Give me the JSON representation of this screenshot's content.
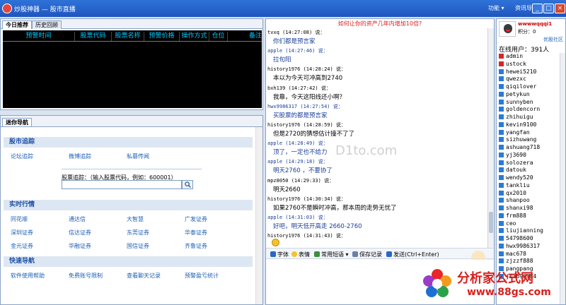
{
  "window": {
    "title": "炒股神器 — 股市直播",
    "menu_function": "功能",
    "menu_info_nav": "资讯导航",
    "min": "_",
    "max": "□",
    "close": "×"
  },
  "top_panel": {
    "tabs": [
      "今日推荐",
      "历史回顾"
    ],
    "columns": [
      "预警时间",
      "股票代码",
      "股票名称",
      "预警价格",
      "操作方式",
      "仓位",
      "备注"
    ]
  },
  "nav_panel": {
    "tab": "迷你导航",
    "sections": {
      "market_tracking": {
        "title": "股市追踪",
        "links": [
          "论坛追踪",
          "微博追踪",
          "私募传闻"
        ],
        "search_label": "股票追踪：（输入股票代码，例如：600001）",
        "search_value": ""
      },
      "realtime": {
        "title": "实时行情",
        "links": [
          "同花顺",
          "通达信",
          "大智慧",
          "广发证券",
          "深圳证券",
          "信达证券",
          "东莞证券",
          "华泰证券",
          "金元证券",
          "华融证券",
          "国信证券",
          "齐鲁证券"
        ]
      },
      "quick": {
        "title": "快速导航",
        "links": [
          "软件使用帮助",
          "免费账号限制",
          "查看聊天记录",
          "预警盈亏统计"
        ]
      }
    }
  },
  "chat": {
    "banner": "如何让你的资产几年内增加10倍?",
    "messages": [
      {
        "header": "tvxq (14:27:08) 说：",
        "body": "你们都是预言家",
        "hcolor": "black",
        "bcolor": "blue"
      },
      {
        "header": "apple (14:27:46) 说：",
        "body": "拉旬阳",
        "hcolor": "blue",
        "bcolor": "blue"
      },
      {
        "header": "history1976 (14:28:24) 说：",
        "body": "本以为今天可冲高到2740",
        "hcolor": "black",
        "bcolor": "black"
      },
      {
        "header": "bxh139 (14:27:42) 说：",
        "body": "我靠，今天这阳线还小啊？",
        "hcolor": "black",
        "bcolor": "black"
      },
      {
        "header": "hwx9986317 (14:27:54) 说：",
        "body": "买股票的都是预言家",
        "hcolor": "blue",
        "bcolor": "blue"
      },
      {
        "header": "history1976 (14:28:59) 说：",
        "body": "但是2720的猜想估计撞不了了",
        "hcolor": "black",
        "bcolor": "black"
      },
      {
        "header": "apple (14:28:49) 说：",
        "body": "顶了，一定也不给力",
        "hcolor": "blue",
        "bcolor": "blue"
      },
      {
        "header": "apple (14:29:18) 说：",
        "body": "明天2760 ，不要协了",
        "hcolor": "blue",
        "bcolor": "blue"
      },
      {
        "header": "mpz8050 (14:29:33) 说：",
        "body": "明天2660",
        "hcolor": "black",
        "bcolor": "black"
      },
      {
        "header": "history1976 (14:30:34) 说：",
        "body": "如果2760不是瞬时冲高，那本周的走势无忧了",
        "hcolor": "black",
        "bcolor": "black"
      },
      {
        "header": "apple (14:31:03) 说：",
        "body": "好吧，明天低开高走 2660-2760",
        "hcolor": "blue",
        "bcolor": "blue"
      },
      {
        "header": "history1976 (14:31:43) 说：",
        "body": "",
        "hcolor": "black",
        "bcolor": "black"
      }
    ],
    "toolbar": {
      "font": "字体",
      "emoji": "表情",
      "phrases": "常用短语",
      "save": "保存记录",
      "send": "发送(Ctrl+Enter)"
    },
    "watermark": "D1to.com"
  },
  "users": {
    "name": "wwwwqqqi1",
    "points": "积分：0",
    "community": "优股社区",
    "online": "在线用户：391人",
    "list": [
      {
        "name": "admin",
        "admin": true
      },
      {
        "name": "ustock",
        "admin": true
      },
      {
        "name": "hewei5210",
        "admin": false
      },
      {
        "name": "qwezxc",
        "admin": false
      },
      {
        "name": "qiqilover",
        "admin": false
      },
      {
        "name": "petykun",
        "admin": false
      },
      {
        "name": "sunnyben",
        "admin": false
      },
      {
        "name": "goldencorn",
        "admin": false
      },
      {
        "name": "zhihuigu",
        "admin": false
      },
      {
        "name": "kevin9100",
        "admin": false
      },
      {
        "name": "yangfan",
        "admin": false
      },
      {
        "name": "sizhuwang",
        "admin": false
      },
      {
        "name": "ashuang718",
        "admin": false
      },
      {
        "name": "yj3690",
        "admin": false
      },
      {
        "name": "solozera",
        "admin": false
      },
      {
        "name": "datouk",
        "admin": false
      },
      {
        "name": "wendy520",
        "admin": false
      },
      {
        "name": "tankliu",
        "admin": false
      },
      {
        "name": "qx2010",
        "admin": false
      },
      {
        "name": "shanpoo",
        "admin": false
      },
      {
        "name": "shanxi98",
        "admin": false
      },
      {
        "name": "frm888",
        "admin": false
      },
      {
        "name": "ceo",
        "admin": false
      },
      {
        "name": "liujianning",
        "admin": false
      },
      {
        "name": "54798600",
        "admin": false
      },
      {
        "name": "hwx9986317",
        "admin": false
      },
      {
        "name": "mac678",
        "admin": false
      },
      {
        "name": "zjzzf888",
        "admin": false
      },
      {
        "name": "pangpang",
        "admin": false
      },
      {
        "name": "js3696384",
        "admin": false
      }
    ]
  },
  "ad": {
    "title": "分析家公式网",
    "url": "www.88gs.com"
  },
  "colors": {
    "accent": "#1d5fb5",
    "alert_table_bg": "#000000",
    "alert_header": "#00c8ff",
    "banner": "#d81e1e"
  }
}
